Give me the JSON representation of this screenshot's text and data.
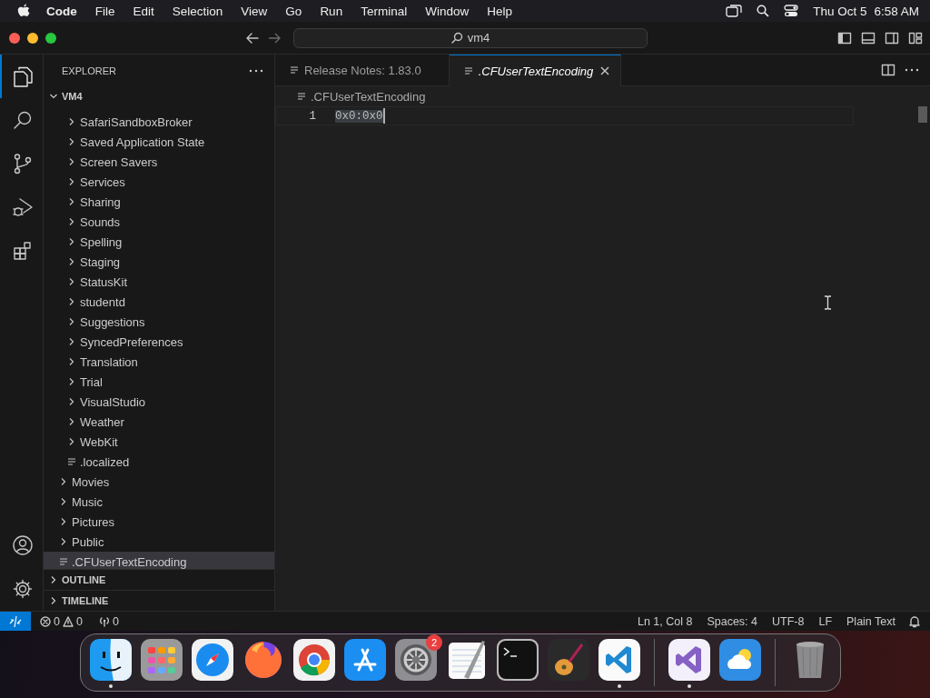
{
  "menu_bar": {
    "app": "Code",
    "items": [
      "File",
      "Edit",
      "Selection",
      "View",
      "Go",
      "Run",
      "Terminal",
      "Window",
      "Help"
    ],
    "date": "Thu Oct 5",
    "time": "6:58 AM"
  },
  "title_bar": {
    "search": "vm4"
  },
  "activity_bar": {
    "items": [
      {
        "kind": "explorer",
        "selected": true
      },
      {
        "kind": "search",
        "selected": false
      },
      {
        "kind": "source-control",
        "selected": false
      },
      {
        "kind": "run-debug",
        "selected": false
      },
      {
        "kind": "extensions",
        "selected": false
      }
    ]
  },
  "explorer": {
    "title": "EXPLORER",
    "root": {
      "label": "VM4",
      "expanded": true,
      "children": [
        {
          "kind": "offscreen",
          "children": [
            {
              "label": "SafariSandboxBroker",
              "kind": "folder",
              "expanded": false,
              "selected": false
            },
            {
              "label": "Saved Application State",
              "kind": "folder",
              "expanded": false,
              "selected": false
            },
            {
              "label": "Screen Savers",
              "kind": "folder",
              "expanded": false,
              "selected": false
            },
            {
              "label": "Services",
              "kind": "folder",
              "expanded": false,
              "selected": false
            },
            {
              "label": "Sharing",
              "kind": "folder",
              "expanded": false,
              "selected": false
            },
            {
              "label": "Sounds",
              "kind": "folder",
              "expanded": false,
              "selected": false
            },
            {
              "label": "Spelling",
              "kind": "folder",
              "expanded": false,
              "selected": false
            },
            {
              "label": "Staging",
              "kind": "folder",
              "expanded": false,
              "selected": false
            },
            {
              "label": "StatusKit",
              "kind": "folder",
              "expanded": false,
              "selected": false
            },
            {
              "label": "studentd",
              "kind": "folder",
              "expanded": false,
              "selected": false
            },
            {
              "label": "Suggestions",
              "kind": "folder",
              "expanded": false,
              "selected": false
            },
            {
              "label": "SyncedPreferences",
              "kind": "folder",
              "expanded": false,
              "selected": false
            },
            {
              "label": "Translation",
              "kind": "folder",
              "expanded": false,
              "selected": false
            },
            {
              "label": "Trial",
              "kind": "folder",
              "expanded": false,
              "selected": false
            },
            {
              "label": "VisualStudio",
              "kind": "folder",
              "expanded": false,
              "selected": false
            },
            {
              "label": "Weather",
              "kind": "folder",
              "expanded": false,
              "selected": false
            },
            {
              "label": "WebKit",
              "kind": "folder",
              "expanded": false,
              "selected": false
            },
            {
              "label": ".localized",
              "kind": "file",
              "selected": false
            }
          ]
        },
        {
          "label": "Movies",
          "kind": "folder",
          "expanded": false,
          "selected": false
        },
        {
          "label": "Music",
          "kind": "folder",
          "expanded": false,
          "selected": false
        },
        {
          "label": "Pictures",
          "kind": "folder",
          "expanded": false,
          "selected": false
        },
        {
          "label": "Public",
          "kind": "folder",
          "expanded": false,
          "selected": false
        },
        {
          "label": ".CFUserTextEncoding",
          "kind": "file",
          "selected": true
        }
      ]
    },
    "sections": [
      {
        "label": "OUTLINE",
        "expanded": false
      },
      {
        "label": "TIMELINE",
        "expanded": false
      }
    ]
  },
  "tabs": [
    {
      "label": "Release Notes: 1.83.0",
      "selected": false,
      "preview": false
    },
    {
      "label": ".CFUserTextEncoding",
      "selected": true,
      "preview": true
    }
  ],
  "breadcrumb": ".CFUserTextEncoding",
  "editor": {
    "lines": [
      {
        "number": "1",
        "text": "0x0:0x0"
      }
    ]
  },
  "status_bar": {
    "errors": "0",
    "warnings": "0",
    "ports": "0",
    "items": [
      "Ln 1, Col 8",
      "Spaces: 4",
      "UTF-8",
      "LF",
      "Plain Text"
    ]
  },
  "dock": {
    "apps": [
      {
        "kind": "finder",
        "running": true
      },
      {
        "kind": "launchpad",
        "running": false
      },
      {
        "kind": "safari",
        "running": false
      },
      {
        "kind": "firefox",
        "running": false
      },
      {
        "kind": "chrome",
        "running": false
      },
      {
        "kind": "appstore",
        "running": false
      },
      {
        "kind": "settings",
        "running": false,
        "badge": "2"
      },
      {
        "kind": "textedit",
        "running": false
      },
      {
        "kind": "terminal",
        "running": false
      },
      {
        "kind": "garageband",
        "running": false
      },
      {
        "kind": "vscode",
        "running": true
      },
      {
        "kind": "separator"
      },
      {
        "kind": "visualstudio",
        "running": true
      },
      {
        "kind": "weather",
        "running": false
      },
      {
        "kind": "separator"
      },
      {
        "kind": "trash",
        "running": false
      }
    ]
  }
}
